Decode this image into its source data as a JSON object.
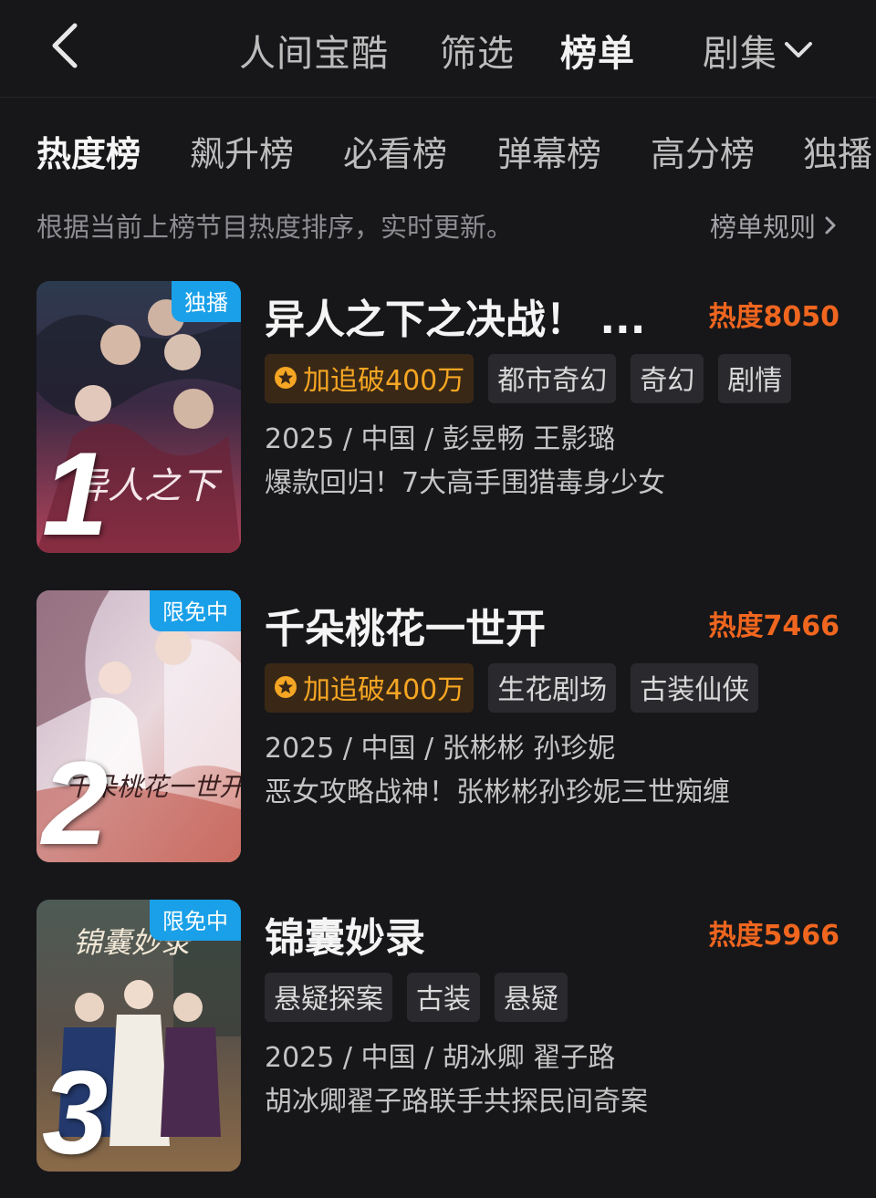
{
  "header": {
    "nav": [
      "人间宝酷",
      "筛选",
      "榜单",
      "剧集"
    ]
  },
  "subtabs": [
    "热度榜",
    "飙升榜",
    "必看榜",
    "弹幕榜",
    "高分榜",
    "独播"
  ],
  "description": "根据当前上榜节目热度排序，实时更新。",
  "rules_label": "榜单规则",
  "items": [
    {
      "rank": "1",
      "badge": "独播",
      "title": "异人之下之决战！ ...",
      "heat": "热度8050",
      "hot_tag": "加追破400万",
      "tags": [
        "都市奇幻",
        "奇幻",
        "剧情"
      ],
      "meta": "2025 / 中国 / 彭昱畅 王影璐",
      "slogan": "爆款回归！7大高手围猎毒身少女",
      "poster_text": "异人之下"
    },
    {
      "rank": "2",
      "badge": "限免中",
      "title": "千朵桃花一世开",
      "heat": "热度7466",
      "hot_tag": "加追破400万",
      "tags": [
        "生花剧场",
        "古装仙侠"
      ],
      "meta": "2025 / 中国 / 张彬彬 孙珍妮",
      "slogan": "恶女攻略战神！张彬彬孙珍妮三世痴缠",
      "poster_text": "千朵桃花一世开"
    },
    {
      "rank": "3",
      "badge": "限免中",
      "title": "锦囊妙录",
      "heat": "热度5966",
      "hot_tag": "",
      "tags": [
        "悬疑探案",
        "古装",
        "悬疑"
      ],
      "meta": "2025 / 中国 / 胡冰卿 翟子路",
      "slogan": "胡冰卿翟子路联手共探民间奇案",
      "poster_text": "锦囊妙录"
    }
  ],
  "colors": {
    "background": "#17171a",
    "heat": "#f0661f",
    "hot_tag": "#f5a623",
    "badge": "#1aa0e8"
  }
}
